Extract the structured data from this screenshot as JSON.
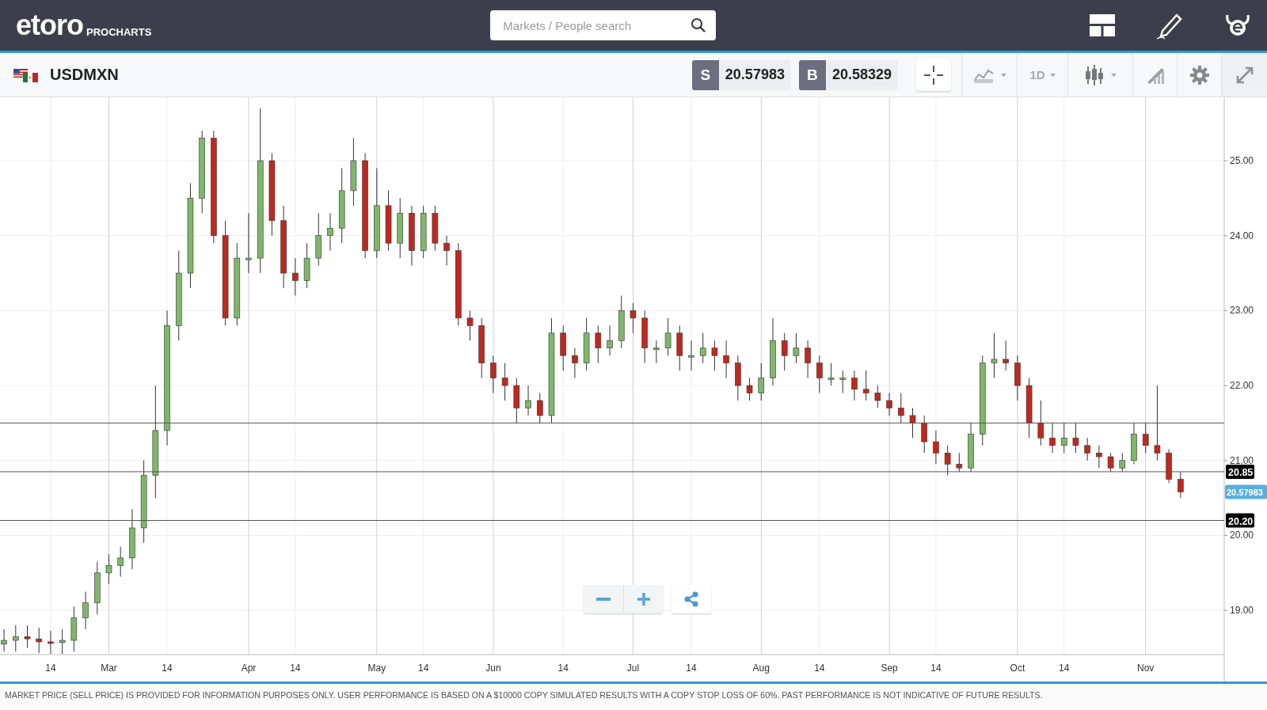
{
  "header": {
    "logo": "etoro",
    "product": "PROCHARTS"
  },
  "search": {
    "placeholder": "Markets / People search"
  },
  "instrument": {
    "symbol": "USDMXN"
  },
  "quotes": [
    {
      "label": "S",
      "price": "20.57983"
    },
    {
      "label": "B",
      "price": "20.58329"
    }
  ],
  "toolbar": {
    "timeframe": "1D",
    "crosshair_on": true
  },
  "chart": {
    "chart_data": {
      "type": "candlestick",
      "ohlc": [
        [
          18.55,
          18.75,
          18.45,
          18.6
        ],
        [
          18.6,
          18.8,
          18.45,
          18.65
        ],
        [
          18.65,
          18.8,
          18.5,
          18.62
        ],
        [
          18.62,
          18.77,
          18.43,
          18.58
        ],
        [
          18.58,
          18.73,
          18.42,
          18.57
        ],
        [
          18.57,
          18.75,
          18.42,
          18.6
        ],
        [
          18.6,
          19.05,
          18.45,
          18.9
        ],
        [
          18.9,
          19.25,
          18.75,
          19.1
        ],
        [
          19.1,
          19.65,
          18.95,
          19.5
        ],
        [
          19.5,
          19.75,
          19.35,
          19.6
        ],
        [
          19.6,
          19.85,
          19.45,
          19.7
        ],
        [
          19.7,
          20.35,
          19.55,
          20.1
        ],
        [
          20.1,
          21.0,
          19.9,
          20.8
        ],
        [
          20.8,
          22.0,
          20.5,
          21.4
        ],
        [
          21.4,
          23.0,
          21.2,
          22.8
        ],
        [
          22.8,
          23.8,
          22.6,
          23.5
        ],
        [
          23.5,
          24.7,
          23.3,
          24.5
        ],
        [
          24.5,
          25.4,
          24.3,
          25.3
        ],
        [
          25.3,
          25.4,
          23.9,
          24.0
        ],
        [
          24.0,
          24.2,
          22.8,
          22.9
        ],
        [
          22.9,
          23.9,
          22.8,
          23.7
        ],
        [
          23.7,
          24.3,
          23.5,
          23.7
        ],
        [
          23.7,
          25.7,
          23.5,
          25.0
        ],
        [
          25.0,
          25.1,
          24.0,
          24.2
        ],
        [
          24.2,
          24.4,
          23.3,
          23.5
        ],
        [
          23.5,
          23.7,
          23.2,
          23.4
        ],
        [
          23.4,
          23.9,
          23.3,
          23.7
        ],
        [
          23.7,
          24.3,
          23.6,
          24.0
        ],
        [
          24.0,
          24.3,
          23.8,
          24.1
        ],
        [
          24.1,
          24.9,
          23.9,
          24.6
        ],
        [
          24.6,
          25.3,
          24.4,
          25.0
        ],
        [
          25.0,
          25.1,
          23.7,
          23.8
        ],
        [
          23.8,
          24.9,
          23.7,
          24.4
        ],
        [
          24.4,
          24.6,
          23.8,
          23.9
        ],
        [
          23.9,
          24.5,
          23.7,
          24.3
        ],
        [
          24.3,
          24.4,
          23.6,
          23.8
        ],
        [
          23.8,
          24.4,
          23.7,
          24.3
        ],
        [
          24.3,
          24.4,
          23.8,
          23.9
        ],
        [
          23.9,
          24.0,
          23.6,
          23.8
        ],
        [
          23.8,
          23.9,
          22.8,
          22.9
        ],
        [
          22.9,
          23.0,
          22.6,
          22.8
        ],
        [
          22.8,
          22.9,
          22.1,
          22.3
        ],
        [
          22.3,
          22.4,
          21.9,
          22.1
        ],
        [
          22.1,
          22.3,
          21.8,
          22.0
        ],
        [
          22.0,
          22.1,
          21.5,
          21.7
        ],
        [
          21.7,
          22.0,
          21.6,
          21.8
        ],
        [
          21.8,
          21.9,
          21.5,
          21.6
        ],
        [
          21.6,
          22.9,
          21.5,
          22.7
        ],
        [
          22.7,
          22.8,
          22.2,
          22.4
        ],
        [
          22.4,
          22.5,
          22.1,
          22.3
        ],
        [
          22.3,
          22.9,
          22.2,
          22.7
        ],
        [
          22.7,
          22.8,
          22.3,
          22.5
        ],
        [
          22.5,
          22.8,
          22.4,
          22.6
        ],
        [
          22.6,
          23.2,
          22.5,
          23.0
        ],
        [
          23.0,
          23.1,
          22.7,
          22.9
        ],
        [
          22.9,
          23.0,
          22.3,
          22.5
        ],
        [
          22.5,
          22.6,
          22.3,
          22.5
        ],
        [
          22.5,
          22.9,
          22.4,
          22.7
        ],
        [
          22.7,
          22.8,
          22.2,
          22.4
        ],
        [
          22.4,
          22.6,
          22.2,
          22.4
        ],
        [
          22.4,
          22.7,
          22.3,
          22.5
        ],
        [
          22.5,
          22.6,
          22.2,
          22.4
        ],
        [
          22.4,
          22.6,
          22.1,
          22.3
        ],
        [
          22.3,
          22.4,
          21.8,
          22.0
        ],
        [
          22.0,
          22.1,
          21.8,
          21.9
        ],
        [
          21.9,
          22.3,
          21.8,
          22.1
        ],
        [
          22.1,
          22.9,
          22.0,
          22.6
        ],
        [
          22.6,
          22.7,
          22.2,
          22.4
        ],
        [
          22.4,
          22.7,
          22.3,
          22.5
        ],
        [
          22.5,
          22.6,
          22.1,
          22.3
        ],
        [
          22.3,
          22.4,
          21.9,
          22.1
        ],
        [
          22.1,
          22.3,
          22.0,
          22.1
        ],
        [
          22.1,
          22.2,
          21.9,
          22.1
        ],
        [
          22.1,
          22.2,
          21.8,
          21.95
        ],
        [
          21.95,
          22.2,
          21.8,
          21.9
        ],
        [
          21.9,
          22.0,
          21.7,
          21.8
        ],
        [
          21.8,
          21.9,
          21.6,
          21.7
        ],
        [
          21.7,
          21.9,
          21.5,
          21.6
        ],
        [
          21.6,
          21.7,
          21.3,
          21.5
        ],
        [
          21.5,
          21.6,
          21.1,
          21.25
        ],
        [
          21.25,
          21.4,
          20.95,
          21.1
        ],
        [
          21.1,
          21.2,
          20.8,
          20.95
        ],
        [
          20.95,
          21.1,
          20.85,
          20.9
        ],
        [
          20.9,
          21.5,
          20.85,
          21.35
        ],
        [
          21.35,
          22.4,
          21.2,
          22.3
        ],
        [
          22.3,
          22.7,
          22.1,
          22.35
        ],
        [
          22.35,
          22.6,
          22.2,
          22.3
        ],
        [
          22.3,
          22.4,
          21.8,
          22.0
        ],
        [
          22.0,
          22.1,
          21.3,
          21.5
        ],
        [
          21.5,
          21.8,
          21.2,
          21.3
        ],
        [
          21.3,
          21.5,
          21.1,
          21.2
        ],
        [
          21.2,
          21.5,
          21.1,
          21.3
        ],
        [
          21.3,
          21.5,
          21.1,
          21.2
        ],
        [
          21.2,
          21.3,
          21.0,
          21.1
        ],
        [
          21.1,
          21.2,
          20.9,
          21.05
        ],
        [
          21.05,
          21.1,
          20.85,
          20.9
        ],
        [
          20.9,
          21.1,
          20.85,
          21.0
        ],
        [
          21.0,
          21.5,
          20.95,
          21.35
        ],
        [
          21.35,
          21.5,
          21.1,
          21.2
        ],
        [
          21.2,
          22.0,
          21.0,
          21.1
        ],
        [
          21.1,
          21.15,
          20.7,
          20.75
        ],
        [
          20.75,
          20.85,
          20.5,
          20.58
        ]
      ],
      "categories": [
        null,
        null,
        null,
        null,
        "14",
        null,
        null,
        null,
        null,
        "Mar",
        null,
        null,
        null,
        null,
        "14",
        null,
        null,
        null,
        null,
        null,
        null,
        "Apr",
        null,
        null,
        null,
        "14",
        null,
        null,
        null,
        null,
        null,
        null,
        "May",
        null,
        null,
        null,
        "14",
        null,
        null,
        null,
        null,
        null,
        "Jun",
        null,
        null,
        null,
        null,
        null,
        "14",
        null,
        null,
        null,
        null,
        null,
        "Jul",
        null,
        null,
        null,
        null,
        "14",
        null,
        null,
        null,
        null,
        null,
        "Aug",
        null,
        null,
        null,
        null,
        "14",
        null,
        null,
        null,
        null,
        null,
        "Sep",
        null,
        null,
        null,
        "14",
        null,
        null,
        null,
        null,
        null,
        null,
        "Oct",
        null,
        null,
        null,
        "14",
        null,
        null,
        null,
        null,
        null,
        null,
        "Nov",
        null,
        null,
        null
      ],
      "ylim": [
        18.41,
        25.845
      ],
      "yticks": [
        {
          "value": 19,
          "label": "19.00"
        },
        {
          "value": 20,
          "label": "20.00"
        },
        {
          "value": 21,
          "label": "21.00"
        },
        {
          "value": 22,
          "label": "22.00"
        },
        {
          "value": 23,
          "label": "23.00"
        },
        {
          "value": 24,
          "label": "24.00"
        },
        {
          "value": 25,
          "label": "25.00"
        }
      ],
      "grid": true,
      "ref_lines": [
        {
          "axis": "y",
          "value": 21.5
        },
        {
          "axis": "y",
          "value": 20.85,
          "label": "20.85"
        },
        {
          "axis": "y",
          "value": 20.2,
          "label": "20.20"
        }
      ],
      "annotations": [
        "20.57983"
      ]
    }
  },
  "disclaimer": "MARKET PRICE (SELL PRICE) IS PROVIDED FOR INFORMATION PURPOSES ONLY. USER PERFORMANCE IS BASED ON A $10000 COPY SIMULATED RESULTS WITH A COPY STOP LOSS OF 60%. PAST PERFORMANCE IS NOT INDICATIVE OF FUTURE RESULTS."
}
